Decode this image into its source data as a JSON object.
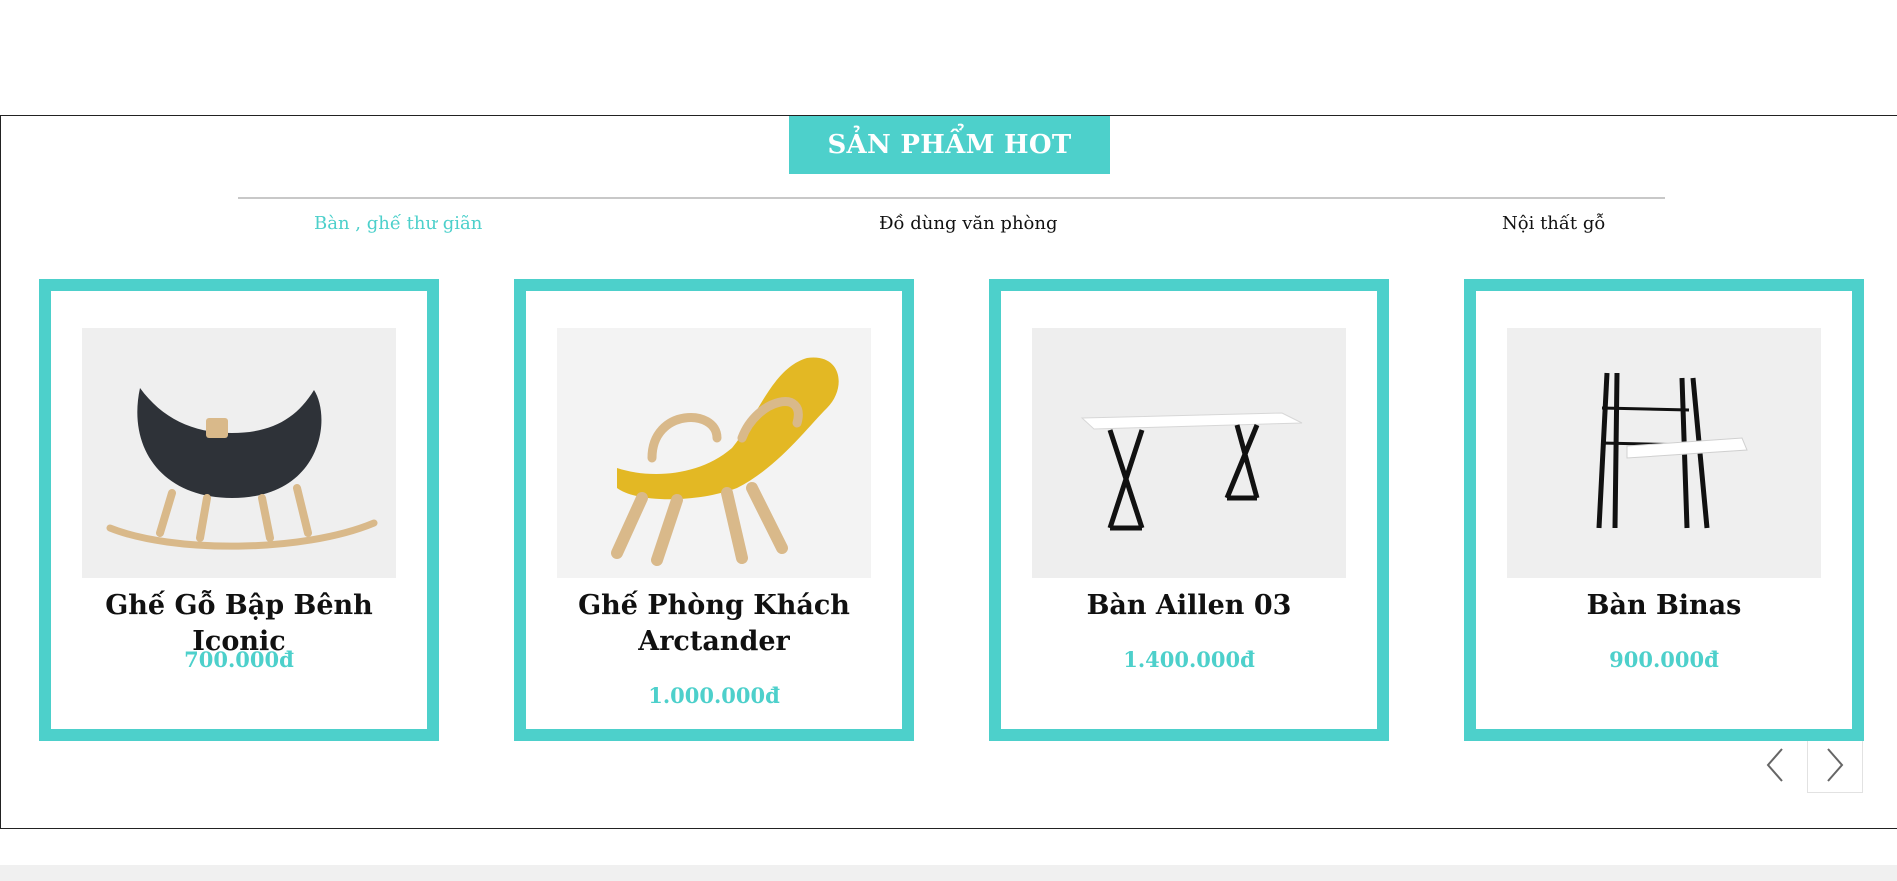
{
  "section": {
    "title": "SẢN PHẨM HOT",
    "tabs": [
      {
        "label": "Bàn , ghế thư giãn",
        "active": true
      },
      {
        "label": "Đồ dùng văn phòng",
        "active": false
      },
      {
        "label": "Nội thất gỗ",
        "active": false
      }
    ]
  },
  "products": [
    {
      "name": "Ghế Gỗ Bập Bênh Iconic",
      "price": "700.000đ",
      "icon": "rocking-chair-icon"
    },
    {
      "name": "Ghế Phòng Khách Arctander",
      "price": "1.000.000đ",
      "icon": "lounge-chair-icon"
    },
    {
      "name": "Bàn Aillen 03",
      "price": "1.400.000đ",
      "icon": "desk-icon"
    },
    {
      "name": "Bàn Binas",
      "price": "900.000đ",
      "icon": "ladder-desk-icon"
    }
  ],
  "carousel": {
    "prev_icon": "chevron-left-icon",
    "next_icon": "chevron-right-icon"
  },
  "colors": {
    "accent": "#4dd0cb",
    "text": "#111111",
    "divider": "#c8c8c8"
  }
}
